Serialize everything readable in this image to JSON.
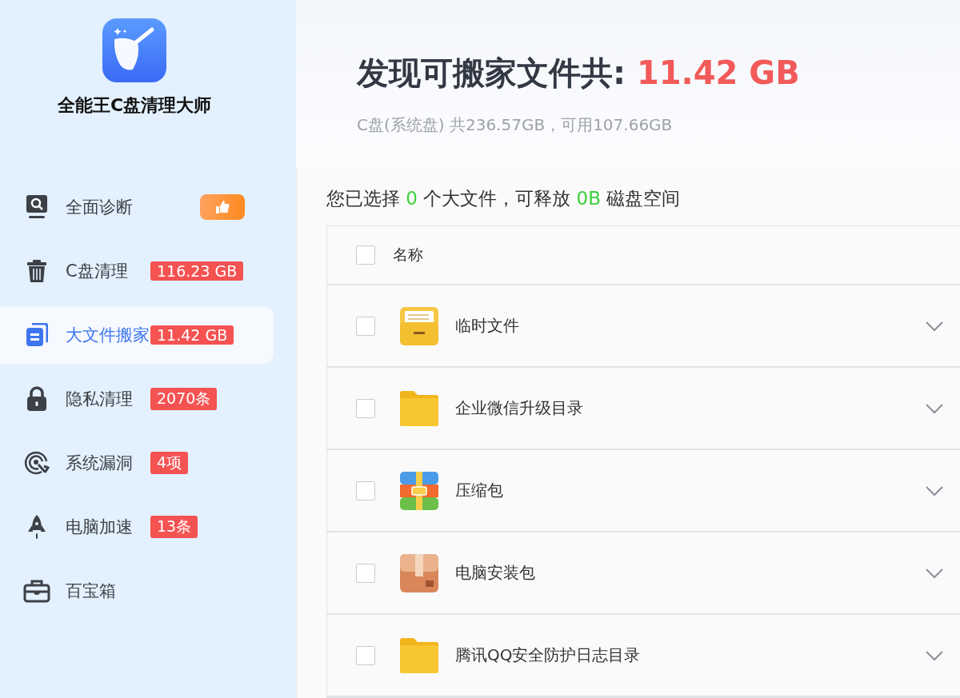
{
  "app": {
    "name": "全能王C盘清理大师"
  },
  "sidebar": {
    "items": [
      {
        "label": "全面诊断",
        "kind": "magnifier",
        "selected": false,
        "badge": {
          "kind": "thumb"
        }
      },
      {
        "label": "C盘清理",
        "kind": "trash",
        "selected": false,
        "badge": {
          "kind": "text",
          "text": "116.23 GB"
        }
      },
      {
        "label": "大文件搬家",
        "kind": "files",
        "selected": true,
        "badge": {
          "kind": "text",
          "text": "11.42 GB"
        }
      },
      {
        "label": "隐私清理",
        "kind": "lock",
        "selected": false,
        "badge": {
          "kind": "text",
          "text": "2070条"
        }
      },
      {
        "label": "系统漏洞",
        "kind": "radar",
        "selected": false,
        "badge": {
          "kind": "text",
          "text": "4项"
        }
      },
      {
        "label": "电脑加速",
        "kind": "rocket",
        "selected": false,
        "badge": {
          "kind": "text",
          "text": "13条"
        }
      },
      {
        "label": "百宝箱",
        "kind": "toolbox",
        "selected": false
      }
    ]
  },
  "header": {
    "title": "发现可搬家文件共: ",
    "total": "11.42 GB",
    "disk_info": "C盘(系统盘) 共236.57GB，可用107.66GB"
  },
  "selection": {
    "parts": [
      {
        "text": "您已选择 ",
        "highlight": false
      },
      {
        "text": "0",
        "highlight": true
      },
      {
        "text": " 个大文件，可释放 ",
        "highlight": false
      },
      {
        "text": "0B",
        "highlight": true
      },
      {
        "text": " 磁盘空间",
        "highlight": false
      }
    ]
  },
  "table": {
    "header": {
      "label": "名称",
      "checked": false
    },
    "rows": [
      {
        "name": "临时文件",
        "kind": "drawer",
        "checked": false,
        "expanded": false
      },
      {
        "name": "企业微信升级目录",
        "kind": "folder",
        "checked": false,
        "expanded": false
      },
      {
        "name": "压缩包",
        "kind": "archive",
        "checked": false,
        "expanded": false
      },
      {
        "name": "电脑安装包",
        "kind": "package",
        "checked": false,
        "expanded": false
      },
      {
        "name": "腾讯QQ安全防护日志目录",
        "kind": "folder",
        "checked": false,
        "expanded": false
      }
    ]
  }
}
